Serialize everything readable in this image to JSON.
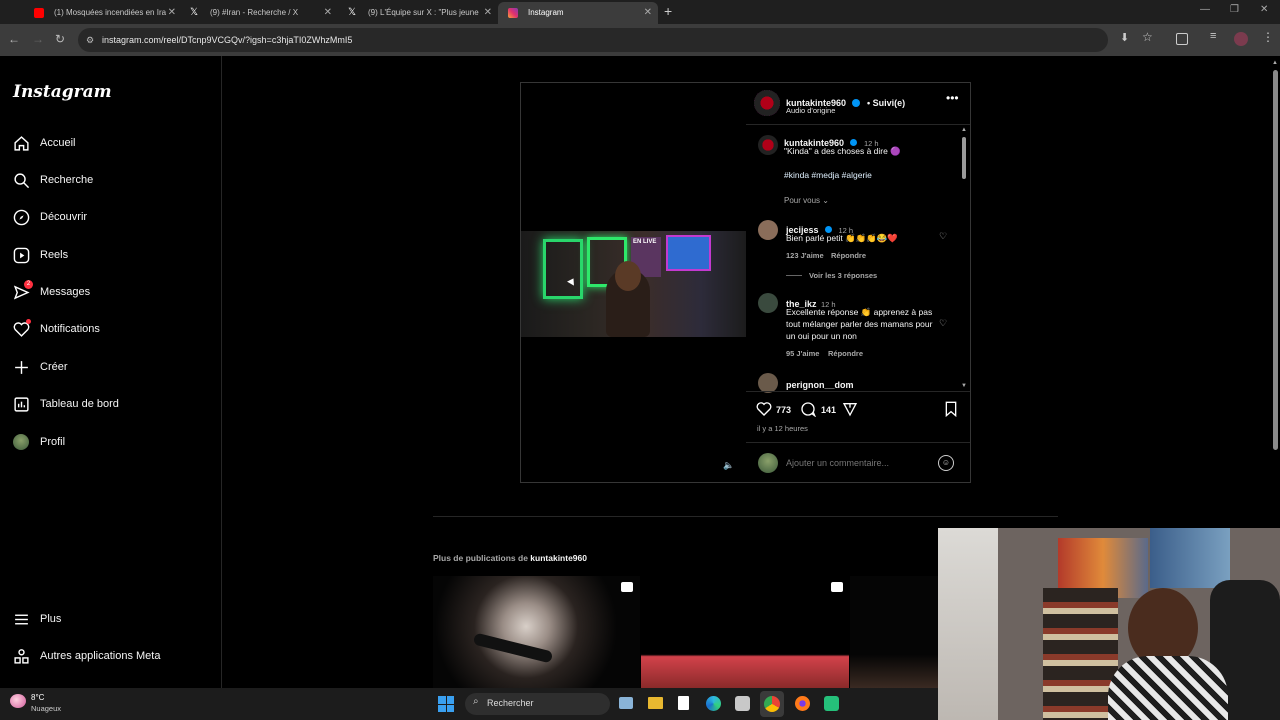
{
  "tabs": [
    {
      "label": "(1) Mosquées incendiées en Ira",
      "favicon_color": "#ff0000"
    },
    {
      "label": "(9) #Iran - Recherche / X",
      "favicon_color": "#ffffff"
    },
    {
      "label": "(9) L'Équipe sur X : \"Plus jeune",
      "favicon_color": "#ffffff"
    },
    {
      "label": "Instagram",
      "favicon_color": "#e1306c"
    }
  ],
  "url": "instagram.com/reel/DTcnp9VCGQv/?igsh=c3hjaTI0ZWhzMmI5",
  "brand": "Instagram",
  "nav": [
    {
      "label": "Accueil",
      "icon": "home-icon"
    },
    {
      "label": "Recherche",
      "icon": "search-icon"
    },
    {
      "label": "Découvrir",
      "icon": "compass-icon"
    },
    {
      "label": "Reels",
      "icon": "reels-icon"
    },
    {
      "label": "Messages",
      "icon": "messenger-icon",
      "badge": "2"
    },
    {
      "label": "Notifications",
      "icon": "heart-icon"
    },
    {
      "label": "Créer",
      "icon": "plus-icon"
    },
    {
      "label": "Tableau de bord",
      "icon": "dashboard-icon"
    },
    {
      "label": "Profil",
      "icon": "profile-avatar-icon"
    }
  ],
  "nav_bottom": [
    {
      "label": "Plus",
      "icon": "menu-icon"
    },
    {
      "label": "Autres applications Meta",
      "icon": "meta-apps-icon"
    }
  ],
  "post": {
    "author": "kuntakinte960",
    "follow_status": "• Suivi(e)",
    "audio": "Audio d'origine",
    "caption_time": "12 h",
    "caption": "\"Kinda\" a des choses à dire 🟣",
    "hashtags": "#kinda #medja #algerie",
    "for_you": "Pour vous",
    "video_overlay_text": "EN LIVE",
    "comments": [
      {
        "user": "jecijess",
        "verified": true,
        "time": "12 h",
        "text": "Bien parlé petit 👏👏👏😂❤️",
        "likes": "123 J'aime",
        "reply": "Répondre",
        "view_replies": "Voir les 3 réponses"
      },
      {
        "user": "the_ikz",
        "verified": false,
        "time": "12 h",
        "text": "Excellente réponse 👏 apprenez à pas tout mélanger parler des mamans pour un oui pour un non",
        "likes": "95 J'aime",
        "reply": "Répondre"
      },
      {
        "user": "perignon__dom",
        "verified": false,
        "time": "",
        "text": ""
      }
    ],
    "like_count": "773",
    "comment_count": "141",
    "posted_ago": "il y a 12 heures",
    "comment_placeholder": "Ajouter un commentaire..."
  },
  "more": {
    "prefix": "Plus de publications de ",
    "author": "kuntakinte960"
  },
  "taskbar": {
    "temp": "8°C",
    "weather": "Nuageux",
    "search": "Rechercher"
  },
  "colors": {
    "verified": "#0095f6",
    "hashtag": "#e0f1ff",
    "badge": "#ff3040",
    "link_blue": "#8cc8ff"
  }
}
